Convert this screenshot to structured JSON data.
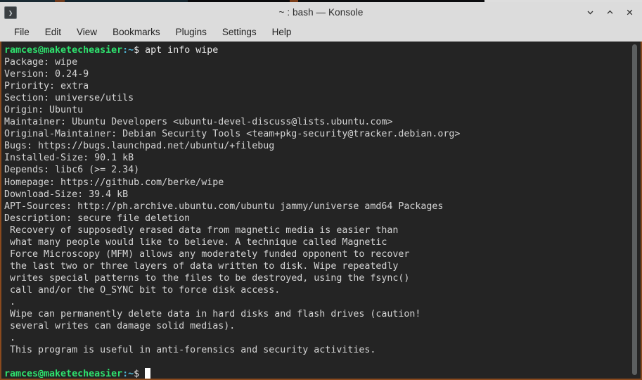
{
  "window": {
    "title": "~ : bash — Konsole",
    "app_icon": "terminal-prompt-icon",
    "icon_glyph": "❯",
    "controls": {
      "minimize": "minimize",
      "maximize": "maximize",
      "close": "close"
    }
  },
  "menubar": {
    "items": [
      {
        "label": "File"
      },
      {
        "label": "Edit"
      },
      {
        "label": "View"
      },
      {
        "label": "Bookmarks"
      },
      {
        "label": "Plugins"
      },
      {
        "label": "Settings"
      },
      {
        "label": "Help"
      }
    ]
  },
  "terminal": {
    "colors": {
      "background": "#242424",
      "foreground": "#d4d4d4",
      "prompt_user_host": "#2ee26e",
      "prompt_path": "#4fb5d6",
      "cursor": "#ffffff",
      "window_border": "#8a4a1e"
    },
    "prompt": {
      "user_host": "ramces@maketecheasier",
      "separator": ":",
      "path": "~",
      "symbol": "$"
    },
    "command": "apt info wipe",
    "output_lines": [
      "Package: wipe",
      "Version: 0.24-9",
      "Priority: extra",
      "Section: universe/utils",
      "Origin: Ubuntu",
      "Maintainer: Ubuntu Developers <ubuntu-devel-discuss@lists.ubuntu.com>",
      "Original-Maintainer: Debian Security Tools <team+pkg-security@tracker.debian.org>",
      "Bugs: https://bugs.launchpad.net/ubuntu/+filebug",
      "Installed-Size: 90.1 kB",
      "Depends: libc6 (>= 2.34)",
      "Homepage: https://github.com/berke/wipe",
      "Download-Size: 39.4 kB",
      "APT-Sources: http://ph.archive.ubuntu.com/ubuntu jammy/universe amd64 Packages",
      "Description: secure file deletion",
      " Recovery of supposedly erased data from magnetic media is easier than",
      " what many people would like to believe. A technique called Magnetic",
      " Force Microscopy (MFM) allows any moderately funded opponent to recover",
      " the last two or three layers of data written to disk. Wipe repeatedly",
      " writes special patterns to the files to be destroyed, using the fsync()",
      " call and/or the O_SYNC bit to force disk access.",
      " .",
      " Wipe can permanently delete data in hard disks and flash drives (caution!",
      " several writes can damage solid medias).",
      " .",
      " This program is useful in anti-forensics and security activities."
    ]
  }
}
